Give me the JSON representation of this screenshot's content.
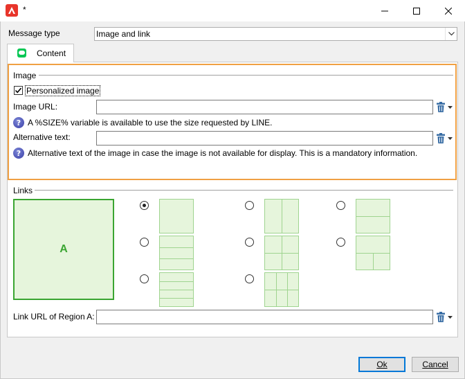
{
  "window": {
    "title": "*",
    "icon": "adobe-campaign-icon",
    "controls": [
      "minimize-icon",
      "maximize-icon",
      "close-icon"
    ]
  },
  "message_type": {
    "label": "Message type",
    "value": "Image and link"
  },
  "tabs": [
    {
      "label": "Content",
      "icon": "line-icon",
      "active": true
    }
  ],
  "image_section": {
    "legend": "Image",
    "personalized": {
      "label": "Personalized image",
      "checked": true
    },
    "image_url": {
      "label": "Image URL:",
      "value": ""
    },
    "image_url_help": "A %SIZE% variable is available to use the size requested by LINE.",
    "alt_text": {
      "label": "Alternative text:",
      "value": ""
    },
    "alt_text_help": "Alternative text of the image in case the image is not available for display. This is a mandatory information."
  },
  "links_section": {
    "legend": "Links",
    "preview_region": "A",
    "selected_layout": 1,
    "link_url": {
      "label": "Link URL of Region A:",
      "value": ""
    }
  },
  "buttons": {
    "ok": "Ok",
    "cancel": "Cancel"
  },
  "colors": {
    "highlight_border": "#f0a043",
    "region_fill": "#e6f5dc",
    "region_border": "#3aa531",
    "layout_line": "#9fd48f",
    "default_button_border": "#0078d7"
  }
}
